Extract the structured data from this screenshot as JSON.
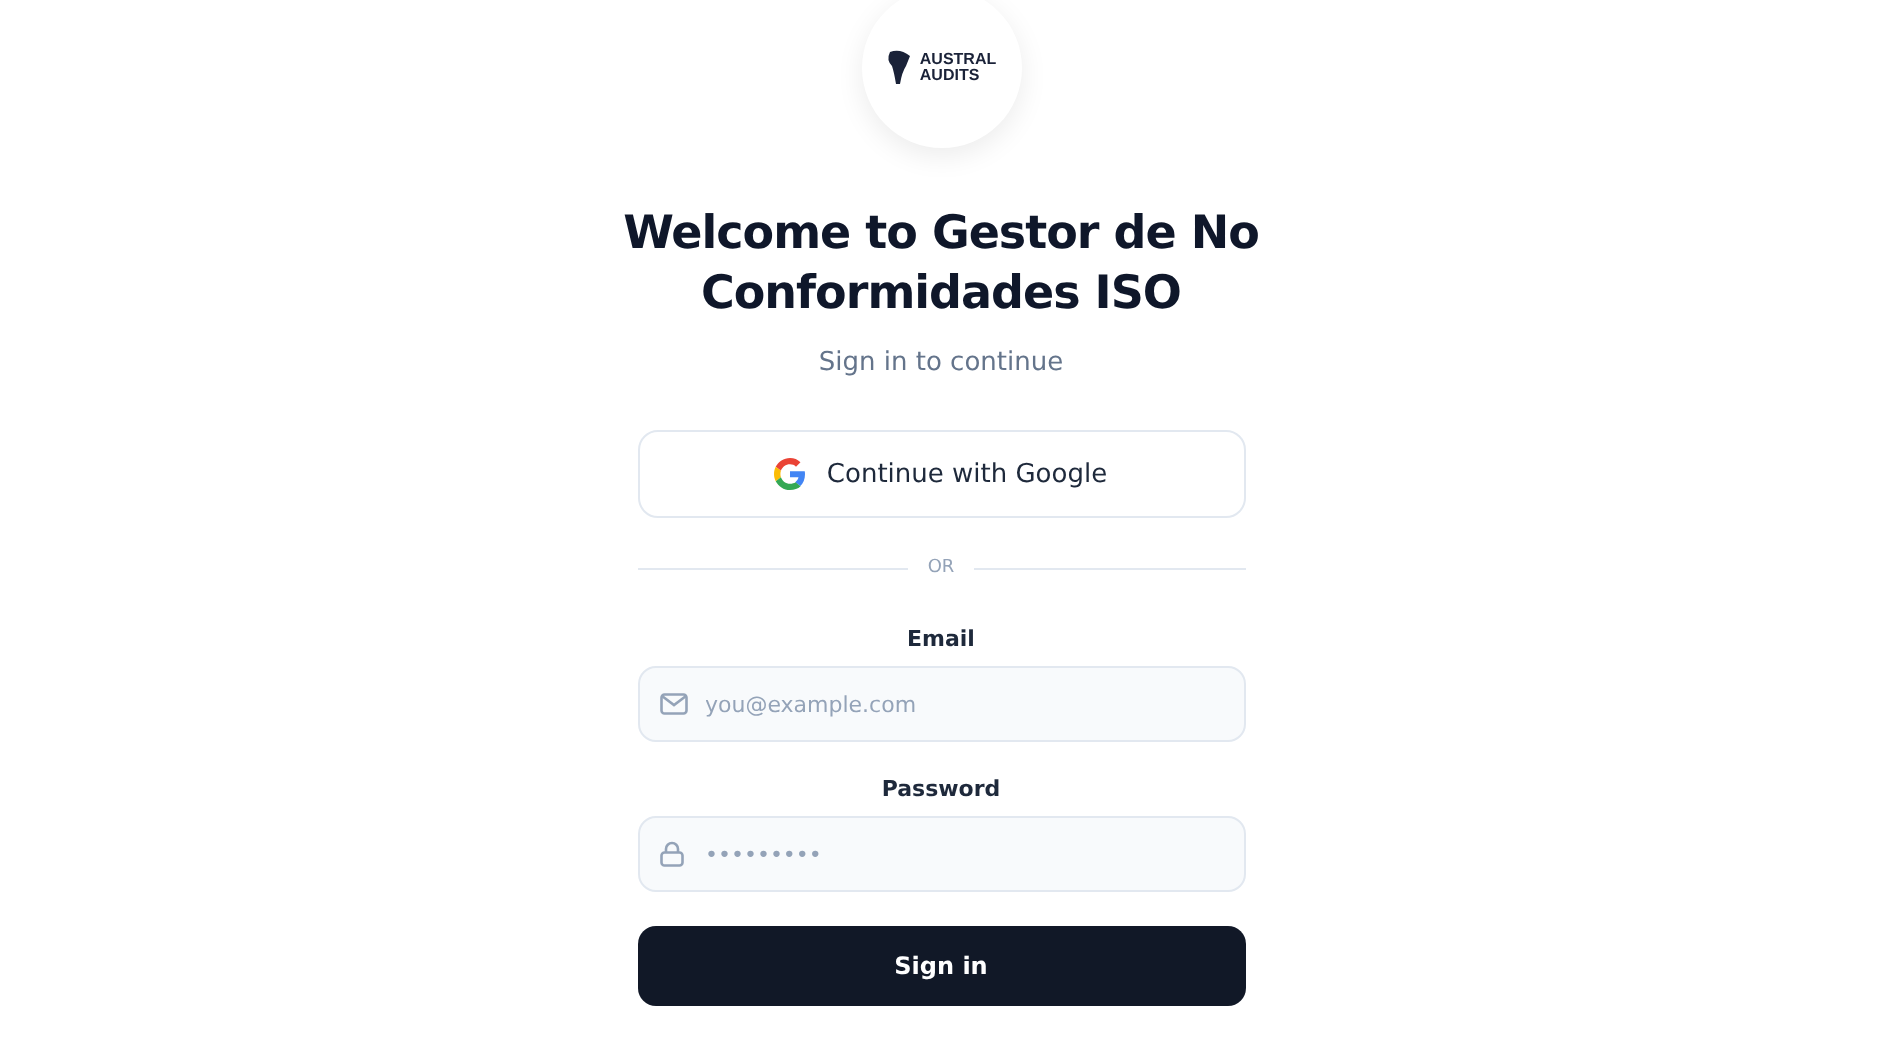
{
  "logo": {
    "line_1": "AUSTRAL",
    "line_2": "AUDITS"
  },
  "title": "Welcome to Gestor de No Conformidades ISO",
  "subtitle": "Sign in to continue",
  "google_button": {
    "label": "Continue with Google"
  },
  "divider": "OR",
  "email": {
    "label": "Email",
    "placeholder": "you@example.com"
  },
  "password": {
    "label": "Password",
    "placeholder": "•••••••••"
  },
  "sign_in_button": {
    "label": "Sign in"
  }
}
